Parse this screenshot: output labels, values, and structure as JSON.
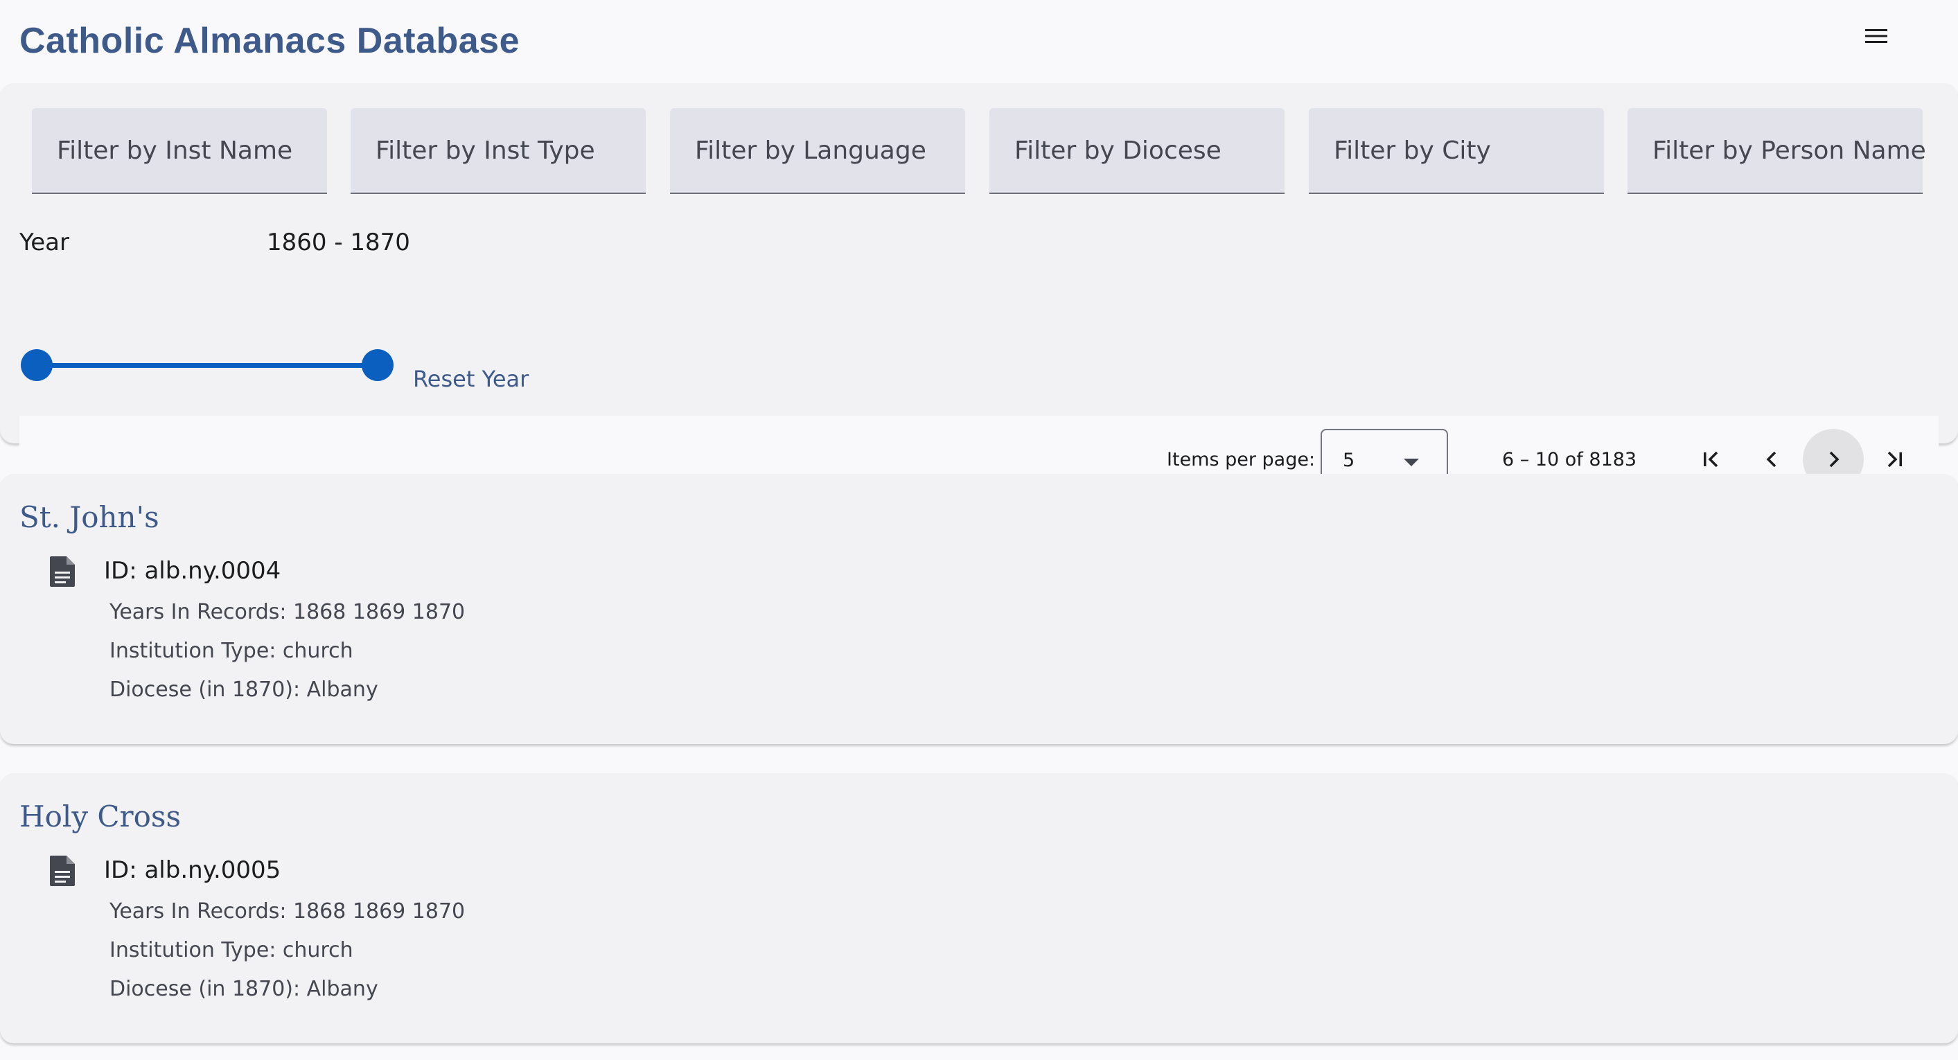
{
  "header": {
    "title": "Catholic Almanacs Database",
    "menu_icon": "hamburger-menu-icon"
  },
  "filters": [
    {
      "placeholder": "Filter by Inst Name"
    },
    {
      "placeholder": "Filter by Inst Type"
    },
    {
      "placeholder": "Filter by Language"
    },
    {
      "placeholder": "Filter by Diocese"
    },
    {
      "placeholder": "Filter by City"
    },
    {
      "placeholder": "Filter by Person Name"
    }
  ],
  "year_filter": {
    "label": "Year",
    "range_text": "1860 - 1870",
    "min": 1860,
    "max": 1870,
    "reset_label": "Reset Year"
  },
  "paginator": {
    "items_per_page_label": "Items per page:",
    "items_per_page_value": "5",
    "range_label": "6 – 10 of 8183",
    "icons": [
      "first-page-icon",
      "previous-page-icon",
      "next-page-icon",
      "last-page-icon"
    ]
  },
  "records": [
    {
      "title": "St. John's",
      "id": "ID: alb.ny.0004",
      "years": "Years In Records: 1868 1869 1870",
      "type": "Institution Type: church",
      "diocese": "Diocese (in 1870): Albany"
    },
    {
      "title": "Holy Cross",
      "id": "ID: alb.ny.0005",
      "years": "Years In Records: 1868 1869 1870",
      "type": "Institution Type: church",
      "diocese": "Diocese (in 1870): Albany"
    }
  ],
  "colors": {
    "accent": "#0a5fbf",
    "title": "#3d5a8a",
    "panel": "#f2f2f4",
    "field": "#e2e3ea"
  }
}
